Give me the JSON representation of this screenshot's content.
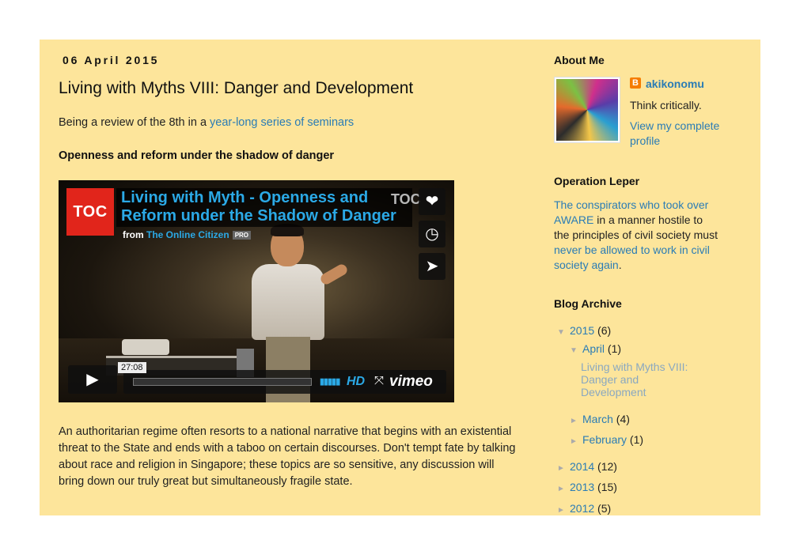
{
  "post": {
    "date": "06 April 2015",
    "title": "Living with Myths VIII: Danger and Development",
    "intro_text": "Being a review of the 8th in a ",
    "intro_link": "year-long series of seminars",
    "subheading": "Openness and reform under the shadow of danger",
    "body": "An authoritarian regime often resorts to a national narrative that begins with an existential threat to the State and ends with a taboo on certain discourses. Don't tempt fate by talking about race and religion in Singapore; these topics are so sensitive, any discussion will bring down our truly great but simultaneously fragile state."
  },
  "video": {
    "logo": "TOC",
    "title": "Living with Myth - Openness and Reform under the Shadow of Danger",
    "from_label": "from",
    "channel": "The Online Citizen",
    "badge": "PRO",
    "corner_logo": "TOC",
    "timecode": "27:08",
    "hd_label": "HD",
    "brand": "vimeo",
    "icons": [
      "heart-icon",
      "clock-icon",
      "send-icon",
      "play-icon",
      "volume-icon",
      "fullscreen-icon"
    ],
    "accent_color": "#2ba9e6"
  },
  "sidebar": {
    "about": {
      "title": "About Me",
      "name": "akikonomu",
      "tagline": "Think critically.",
      "view_profile": "View my complete profile"
    },
    "leper": {
      "title": "Operation Leper",
      "link1": "The conspirators who took over AWARE",
      "text1": " in a manner hostile to the principles of civil society must ",
      "link2": "never be allowed to work in civil society again",
      "text2": "."
    },
    "archive": {
      "title": "Blog Archive",
      "years": [
        {
          "label": "2015",
          "count": "(6)",
          "expanded": true
        },
        {
          "label": "2014",
          "count": "(12)",
          "expanded": false
        },
        {
          "label": "2013",
          "count": "(15)",
          "expanded": false
        },
        {
          "label": "2012",
          "count": "(5)",
          "expanded": false
        }
      ],
      "months": [
        {
          "label": "April",
          "count": "(1)",
          "expanded": true
        },
        {
          "label": "March",
          "count": "(4)",
          "expanded": false
        },
        {
          "label": "February",
          "count": "(1)",
          "expanded": false
        }
      ],
      "post": "Living with Myths VIII: Danger and Development"
    }
  },
  "colors": {
    "page_bg": "#fde59b",
    "link": "#2a7cb5"
  }
}
